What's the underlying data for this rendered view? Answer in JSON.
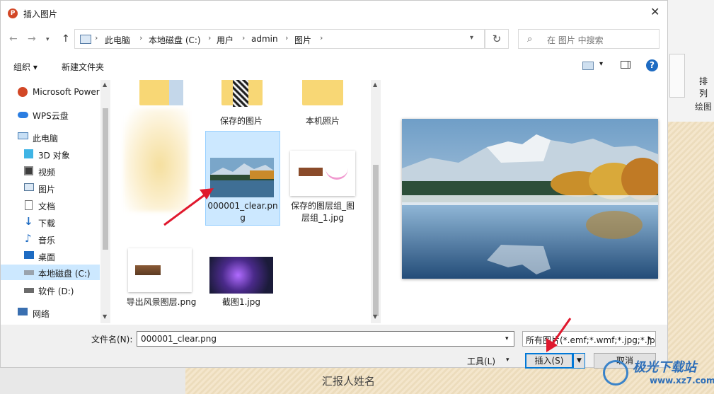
{
  "dialog": {
    "title": "插入图片",
    "app_badge": "P"
  },
  "address": {
    "crumbs": [
      "此电脑",
      "本地磁盘 (C:)",
      "用户",
      "admin",
      "图片"
    ]
  },
  "search": {
    "placeholder": "在 图片 中搜索"
  },
  "toolbar": {
    "organize": "组织 ▾",
    "new_folder": "新建文件夹"
  },
  "sidebar": {
    "items": [
      {
        "label": "Microsoft Power",
        "icon": "powerpoint-icon"
      },
      {
        "label": "WPS云盘",
        "icon": "cloud-icon"
      },
      {
        "label": "此电脑",
        "icon": "computer-icon"
      },
      {
        "label": "3D 对象",
        "icon": "cube-icon"
      },
      {
        "label": "视频",
        "icon": "film-icon"
      },
      {
        "label": "图片",
        "icon": "picture-icon"
      },
      {
        "label": "文档",
        "icon": "document-icon"
      },
      {
        "label": "下载",
        "icon": "download-icon"
      },
      {
        "label": "音乐",
        "icon": "music-icon"
      },
      {
        "label": "桌面",
        "icon": "desktop-icon"
      },
      {
        "label": "本地磁盘 (C:)",
        "icon": "drive-icon"
      },
      {
        "label": "软件 (D:)",
        "icon": "drive-icon"
      },
      {
        "label": "网络",
        "icon": "network-icon"
      }
    ]
  },
  "files": [
    {
      "name": "保存的图片"
    },
    {
      "name": "本机照片"
    },
    {
      "name": "000001_clear.png"
    },
    {
      "name": "保存的图层组_图层组_1.jpg"
    },
    {
      "name": "导出风景图层.png"
    },
    {
      "name": "截图1.jpg"
    }
  ],
  "footer": {
    "filename_label": "文件名(N):",
    "filename_value": "000001_clear.png",
    "filetype_value": "所有图片(*.emf;*.wmf;*.jpg;*.jp",
    "tools": "工具(L)",
    "insert": "插入(S)",
    "cancel": "取消"
  },
  "background": {
    "ribbon_label": "绘图",
    "ribbon_btn": "排列",
    "slide_text": "汇报人姓名"
  },
  "watermark": {
    "text": "极光下载站",
    "url": "www.xz7.com"
  },
  "colors": {
    "accent": "#0078d7",
    "selection": "#cce8ff",
    "arrow": "#e0182d"
  }
}
